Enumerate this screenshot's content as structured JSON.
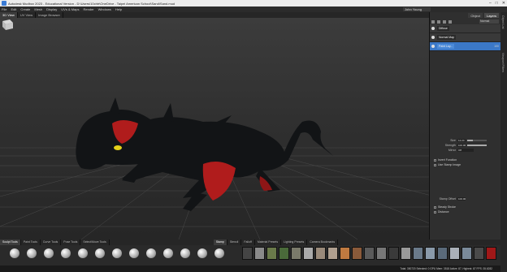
{
  "window": {
    "title": "Autodesk Mudbox 2023 - Educational Version - D:\\Users\\10chtr\\OneDrive - Taipei American School\\Sand\\Sand.mud",
    "controls": [
      "–",
      "□",
      "✕"
    ]
  },
  "menu": [
    "File",
    "Edit",
    "Create",
    "Mesh",
    "Display",
    "UVs & Maps",
    "Render",
    "Windows",
    "Help"
  ],
  "user": "John Young",
  "view_tabs": [
    {
      "label": "3D View",
      "active": true
    },
    {
      "label": "UV View",
      "active": false
    },
    {
      "label": "Image Browser",
      "active": false
    }
  ],
  "right_panel": {
    "tabs": [
      {
        "label": "Object",
        "active": false
      },
      {
        "label": "Layers",
        "active": true
      }
    ],
    "channel_select": "Normal",
    "paint_layers": [
      {
        "name": "Diffuse",
        "value": "",
        "selected": false
      },
      {
        "name": "Normal Map",
        "value": "",
        "selected": false
      },
      {
        "name": "Paint Lay...",
        "value": "100",
        "selected": true
      }
    ],
    "side_tabs": [
      "Object List",
      "Viewport Filters"
    ]
  },
  "properties": {
    "rows": [
      {
        "label": "Size",
        "value": "12.24",
        "level": 0.3
      },
      {
        "label": "Strength",
        "value": "100.00",
        "level": 1.0
      },
      {
        "label": "Mirror",
        "value": "Off",
        "level": null
      }
    ],
    "checks": [
      {
        "label": "Invert Function",
        "checked": false
      },
      {
        "label": "Use Stamp Image",
        "checked": false
      },
      {
        "label": "Steady Stroke",
        "checked": false
      },
      {
        "label": "Distance",
        "checked": false
      }
    ],
    "stamp_spacing_label": "Stamp Offset",
    "stamp_spacing_value": "100.00"
  },
  "bottom_tabs": {
    "left": [
      {
        "label": "Sculpt Tools",
        "active": true
      },
      {
        "label": "Paint Tools",
        "active": false
      },
      {
        "label": "Curve Tools",
        "active": false
      },
      {
        "label": "Pose Tools",
        "active": false
      },
      {
        "label": "Select/Move Tools",
        "active": false
      }
    ],
    "right": [
      {
        "label": "Stamp",
        "active": true
      },
      {
        "label": "Stencil",
        "active": false
      },
      {
        "label": "Falloff",
        "active": false
      },
      {
        "label": "Material Presets",
        "active": false
      },
      {
        "label": "Lighting Presets",
        "active": false
      },
      {
        "label": "Camera Bookmarks",
        "active": false
      }
    ]
  },
  "status": "Total: 350720   Selected: 0 GPU Mem: 3518   Active: 87, Highest: 87   FPS: 35.6282",
  "colors": {
    "selected_layer": "#3b78c7",
    "creature_red": "#b01c1c",
    "creature_eye": "#e5d21a"
  }
}
